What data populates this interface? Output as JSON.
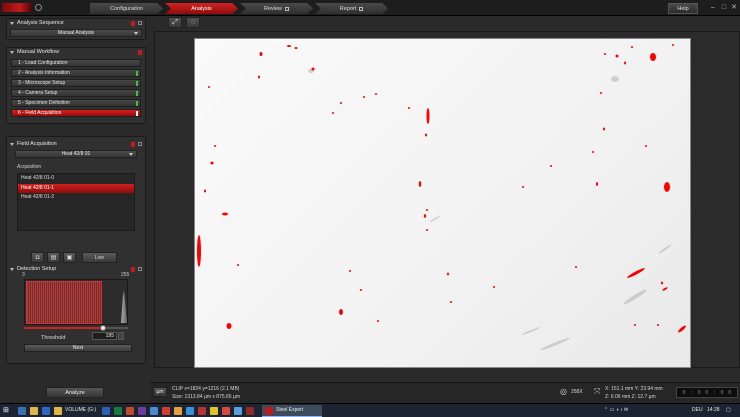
{
  "app": {
    "tabs": [
      {
        "label": "Configuration"
      },
      {
        "label": "Analysis",
        "active": true
      },
      {
        "label": "Review"
      },
      {
        "label": "Report"
      }
    ],
    "help_label": "Help"
  },
  "sidebar": {
    "analysis_sequence": {
      "title": "Analysis Sequence",
      "selected": "Manual Analysis"
    },
    "manual_workflow": {
      "title": "Manual Workflow",
      "steps": [
        {
          "label": "1 - Load Configuration",
          "status": "none"
        },
        {
          "label": "2 - Analysis Information",
          "status": "ok"
        },
        {
          "label": "3 - Microscope Setup",
          "status": "ok"
        },
        {
          "label": "4 - Camera Setup",
          "status": "ok"
        },
        {
          "label": "5 - Specimen Definition",
          "status": "ok"
        },
        {
          "label": "6 - Field Acquisition",
          "status": "current"
        }
      ]
    },
    "field_acquisition": {
      "title": "Field Acquisition",
      "selected": "Heat 42/8 01",
      "acquisition_label": "Acquisition",
      "fields": [
        {
          "label": "Heat 42/8 01-0"
        },
        {
          "label": "Heat 42/8 01-1",
          "selected": true
        },
        {
          "label": "Heat 42/8 01-2"
        }
      ],
      "live_label": "Live"
    },
    "detection_setup": {
      "title": "Detection Setup",
      "hist_min": "3",
      "hist_max": "255",
      "threshold_label": "Threshold",
      "threshold_value": "195",
      "threshold_fraction": 0.76,
      "next_label": "Next"
    }
  },
  "footer": {
    "analyze_label": "Analyze",
    "unit_label": "µm",
    "clip_info": "CLIP x=1824 y=1216 (2.1 MB)",
    "size_info": "Size: 1313.84 µm x 875.65 µm",
    "magnification": "258X",
    "x_coord": "X: 151.1 mm Y: 23.94 mm",
    "z_coord": "Z: 6.06 mm Z: 12.7 µm",
    "digits": "0 : 0 0 : 0 0"
  },
  "taskbar": {
    "volume_label": "VOLUME (G:)",
    "app_label": "Steel Expert",
    "lang": "DEU",
    "time": "14:28"
  },
  "colors": {
    "accent": "#c21b1b",
    "ok": "#3cc23c",
    "inclusion": "#ff0000"
  }
}
